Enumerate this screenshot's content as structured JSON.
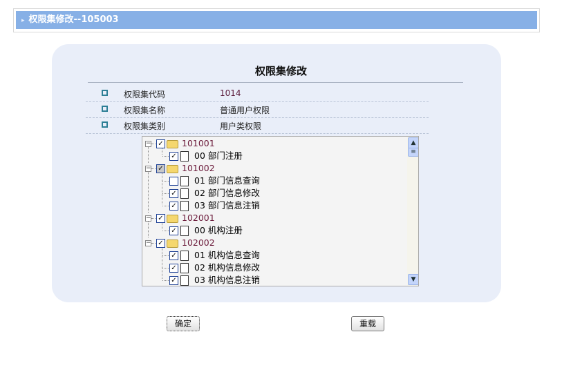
{
  "header": {
    "title": "权限集修改--105003"
  },
  "form": {
    "title": "权限集修改",
    "fields": [
      {
        "label": "权限集代码",
        "value": "1014"
      },
      {
        "label": "权限集名称",
        "value": "普通用户权限"
      },
      {
        "label": "权限集类别",
        "value": "用户类权限"
      }
    ]
  },
  "tree": [
    {
      "code": "101001",
      "checked": true,
      "children": [
        {
          "text": "00 部门注册",
          "checked": true
        }
      ]
    },
    {
      "code": "101002",
      "checked": true,
      "partial": true,
      "children": [
        {
          "text": "01 部门信息查询",
          "checked": false
        },
        {
          "text": "02 部门信息修改",
          "checked": true
        },
        {
          "text": "03 部门信息注销",
          "checked": true
        }
      ]
    },
    {
      "code": "102001",
      "checked": true,
      "children": [
        {
          "text": "00 机构注册",
          "checked": true
        }
      ]
    },
    {
      "code": "102002",
      "checked": true,
      "children": [
        {
          "text": "01 机构信息查询",
          "checked": true
        },
        {
          "text": "02 机构信息修改",
          "checked": true
        },
        {
          "text": "03 机构信息注销",
          "checked": true
        }
      ]
    }
  ],
  "buttons": {
    "confirm": "确定",
    "reset": "重载"
  }
}
